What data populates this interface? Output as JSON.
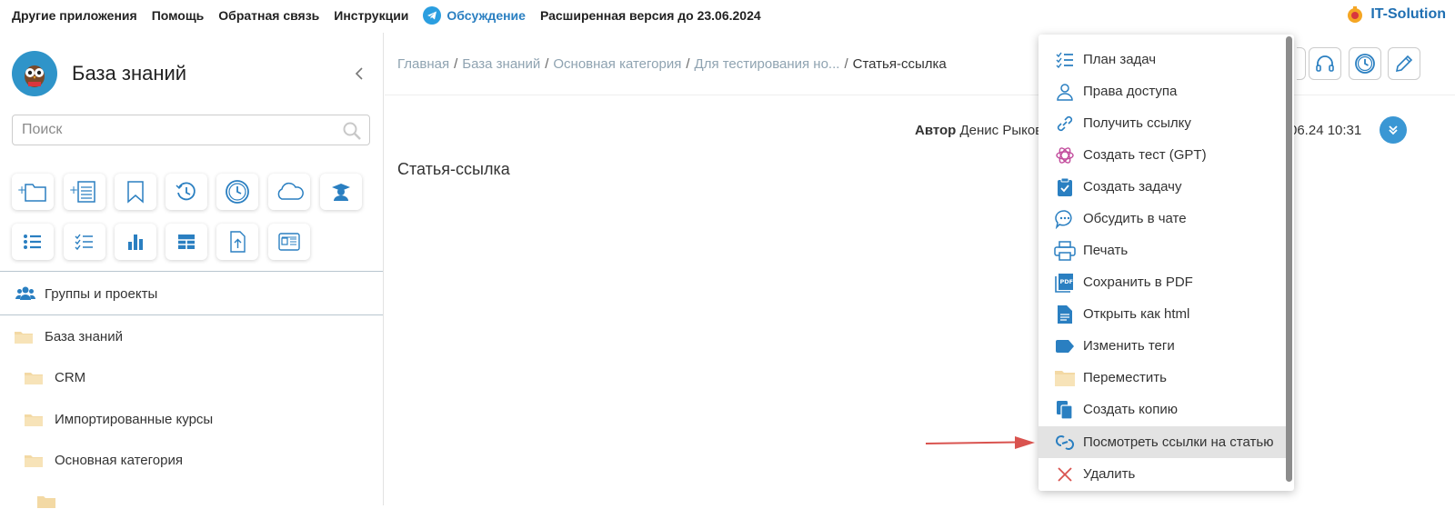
{
  "topbar": {
    "links": [
      "Другие приложения",
      "Помощь",
      "Обратная связь",
      "Инструкции"
    ],
    "telegram_label": "Обсуждение",
    "extended_version": "Расширенная версия до 23.06.2024",
    "brand": "IT-Solution"
  },
  "sidebar": {
    "title": "База знаний",
    "search_placeholder": "Поиск",
    "tool_icons": [
      "add-folder-icon",
      "add-article-icon",
      "bookmark-icon",
      "history-icon",
      "clock-icon",
      "cloud-icon",
      "teacher-icon",
      "list-icon",
      "checklist-icon",
      "bar-chart-icon",
      "table-icon",
      "upload-file-icon",
      "news-icon"
    ],
    "groups_label": "Группы и проекты",
    "tree": [
      {
        "label": "База знаний",
        "level": 0
      },
      {
        "label": "CRM",
        "level": 1
      },
      {
        "label": "Импортированные курсы",
        "level": 1
      },
      {
        "label": "Основная категория",
        "level": 1
      }
    ]
  },
  "main": {
    "breadcrumbs": [
      "Главная",
      "База знаний",
      "Основная категория",
      "Для тестирования но..."
    ],
    "current_crumb": "Статья-ссылка",
    "author_label": "Автор",
    "author_name": "Денис Рыков",
    "date": "06.24 10:31",
    "article_title": "Статья-ссылка"
  },
  "menu": {
    "items": [
      {
        "label": "План задач",
        "icon": "task-plan-icon"
      },
      {
        "label": "Права доступа",
        "icon": "user-icon"
      },
      {
        "label": "Получить ссылку",
        "icon": "link-icon"
      },
      {
        "label": "Создать тест (GPT)",
        "icon": "gpt-icon"
      },
      {
        "label": "Создать задачу",
        "icon": "clipboard-icon"
      },
      {
        "label": "Обсудить в чате",
        "icon": "chat-icon"
      },
      {
        "label": "Печать",
        "icon": "printer-icon"
      },
      {
        "label": "Сохранить в PDF",
        "icon": "pdf-icon"
      },
      {
        "label": "Открыть как html",
        "icon": "file-icon"
      },
      {
        "label": "Изменить теги",
        "icon": "tag-icon"
      },
      {
        "label": "Переместить",
        "icon": "folder-icon"
      },
      {
        "label": "Создать копию",
        "icon": "copy-icon"
      },
      {
        "label": "Посмотреть ссылки на статью",
        "icon": "links-icon",
        "highlighted": true
      },
      {
        "label": "Удалить",
        "icon": "delete-icon"
      }
    ]
  },
  "colors": {
    "accent": "#2f94c9",
    "link_blue": "#1f6fb2",
    "arrow": "#d9534f",
    "highlight": "#e3e3e3"
  }
}
